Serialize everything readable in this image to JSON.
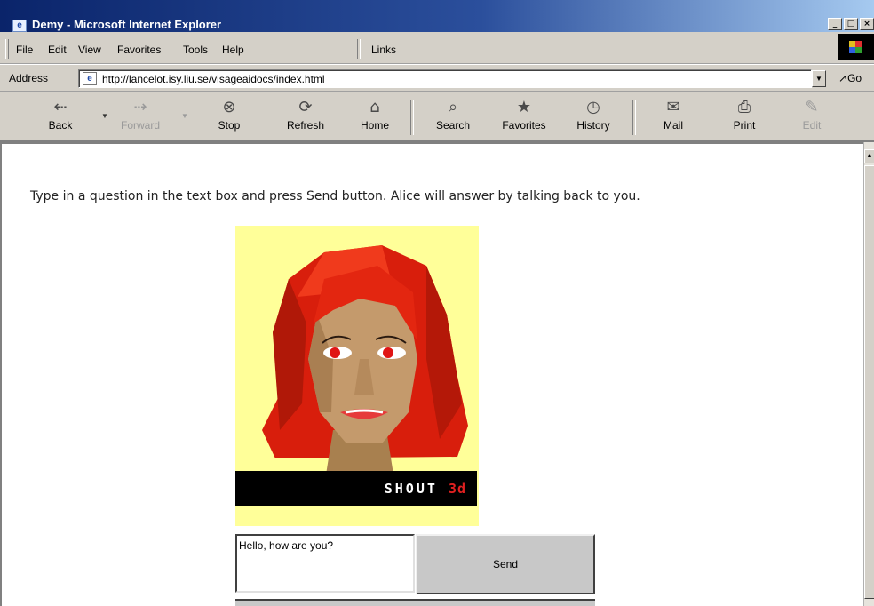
{
  "window": {
    "title": "Demy - Microsoft Internet Explorer",
    "buttons": [
      "_",
      "□",
      "×"
    ]
  },
  "menu": {
    "items": [
      "File",
      "Edit",
      "View",
      "Favorites",
      "Tools",
      "Help"
    ],
    "links_label": "Links"
  },
  "address": {
    "label": "Address",
    "url": "http://lancelot.isy.liu.se/visageaidocs/index.html",
    "go_label": "Go"
  },
  "toolbar": {
    "buttons": [
      {
        "label": "Back",
        "icon": "back-arrow-icon"
      },
      {
        "label": "Forward",
        "icon": "forward-arrow-icon"
      },
      {
        "label": "Stop",
        "icon": "stop-icon"
      },
      {
        "label": "Refresh",
        "icon": "refresh-icon"
      },
      {
        "label": "Home",
        "icon": "home-icon"
      },
      {
        "label": "Search",
        "icon": "search-icon"
      },
      {
        "label": "Favorites",
        "icon": "favorites-icon"
      },
      {
        "label": "History",
        "icon": "history-icon"
      },
      {
        "label": "Mail",
        "icon": "mail-icon"
      },
      {
        "label": "Print",
        "icon": "print-icon"
      },
      {
        "label": "Edit",
        "icon": "edit-icon"
      }
    ]
  },
  "page": {
    "intro": "Type in a question in the text box and press Send button. Alice will answer by talking back to you.",
    "brand": "SHOUT",
    "brand_accent": "3d",
    "question_value": "Hello, how are you?",
    "send_label": "Send"
  },
  "colors": {
    "avatar_bg": "#ffff99",
    "hair": "#e02010",
    "skin": "#c49a6c",
    "title_gradient_start": "#0a246a"
  }
}
